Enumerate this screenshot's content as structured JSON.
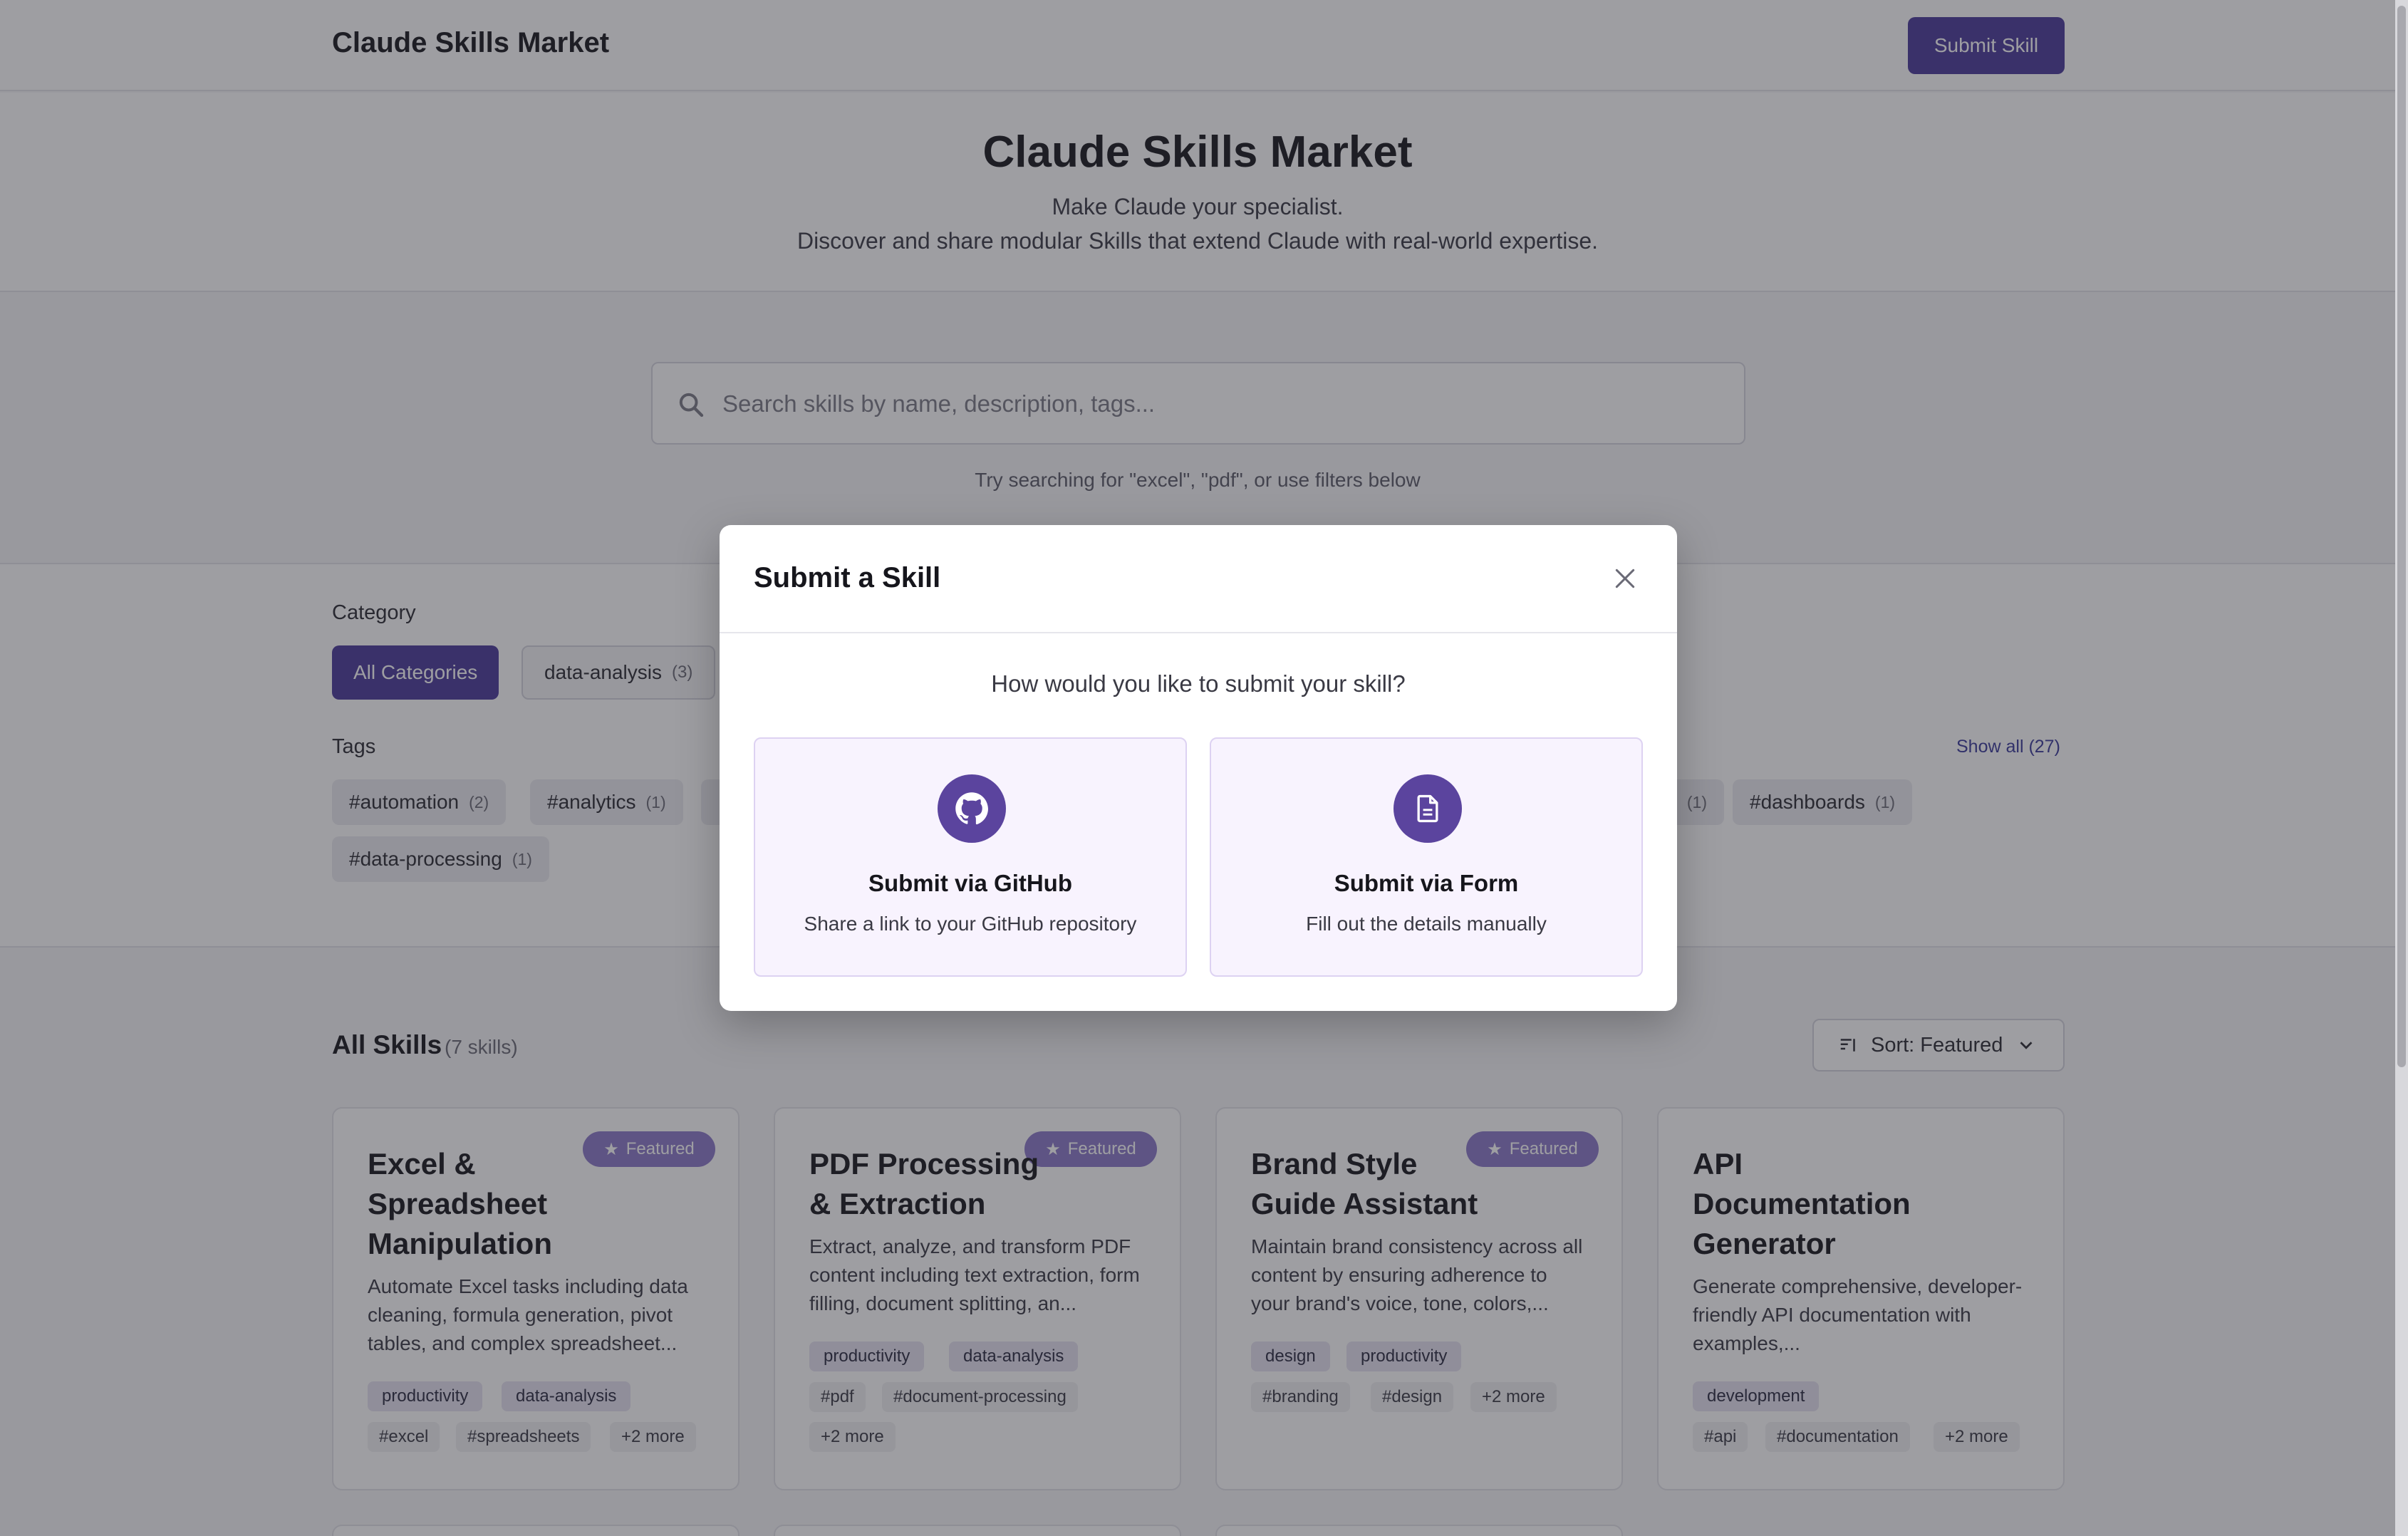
{
  "header": {
    "brand": "Claude Skills Market",
    "submit_label": "Submit Skill"
  },
  "hero": {
    "title": "Claude Skills Market",
    "tagline": "Make Claude your specialist.",
    "subtitle": "Discover and share modular Skills that extend Claude with real-world expertise."
  },
  "search": {
    "placeholder": "Search skills by name, description, tags...",
    "value": "",
    "hint": "Try searching for \"excel\", \"pdf\", or use filters below"
  },
  "filters": {
    "category_label": "Category",
    "categories": [
      {
        "label": "All Categories",
        "count": "",
        "active": true
      },
      {
        "label": "data-analysis",
        "count": "(3)"
      }
    ],
    "tags_label": "Tags",
    "show_all": "Show all (27)",
    "tags": [
      {
        "label": "#automation",
        "count": "(2)"
      },
      {
        "label": "#analytics",
        "count": "(1)"
      },
      {
        "label": "#dashboards",
        "count": "(1)"
      },
      {
        "label": "#data-processing",
        "count": "(1)"
      }
    ],
    "hidden_tag_count": "(1)"
  },
  "skills": {
    "title": "All Skills",
    "count": "(7 skills)",
    "sort_label": "Sort: Featured",
    "featured_label": "Featured",
    "cards": [
      {
        "title": "Excel & Spreadsheet Manipulation",
        "featured": true,
        "desc": "Automate Excel tasks including data cleaning, formula generation, pivot tables, and complex spreadsheet...",
        "categories": [
          "productivity",
          "data-analysis"
        ],
        "tags": [
          "#excel",
          "#spreadsheets",
          "+2 more"
        ]
      },
      {
        "title": "PDF Processing & Extraction",
        "featured": true,
        "desc": "Extract, analyze, and transform PDF content including text extraction, form filling, document splitting, an...",
        "categories": [
          "productivity",
          "data-analysis"
        ],
        "tags": [
          "#pdf",
          "#document-processing",
          "+2 more"
        ]
      },
      {
        "title": "Brand Style Guide Assistant",
        "featured": true,
        "desc": "Maintain brand consistency across all content by ensuring adherence to your brand's voice, tone, colors,...",
        "categories": [
          "design",
          "productivity"
        ],
        "tags": [
          "#branding",
          "#design",
          "+2 more"
        ]
      },
      {
        "title": "API Documentation Generator",
        "featured": false,
        "desc": "Generate comprehensive, developer-friendly API documentation with examples,...",
        "categories": [
          "development"
        ],
        "tags": [
          "#api",
          "#documentation",
          "+2 more"
        ]
      }
    ]
  },
  "modal": {
    "title": "Submit a Skill",
    "question": "How would you like to submit your skill?",
    "options": [
      {
        "title": "Submit via GitHub",
        "desc": "Share a link to your GitHub repository",
        "icon": "github-icon"
      },
      {
        "title": "Submit via Form",
        "desc": "Fill out the details manually",
        "icon": "document-icon"
      }
    ]
  },
  "colors": {
    "accent": "#4a3a9a",
    "featured_badge": "#8a78c8",
    "option_bg": "#f8f3fe"
  }
}
